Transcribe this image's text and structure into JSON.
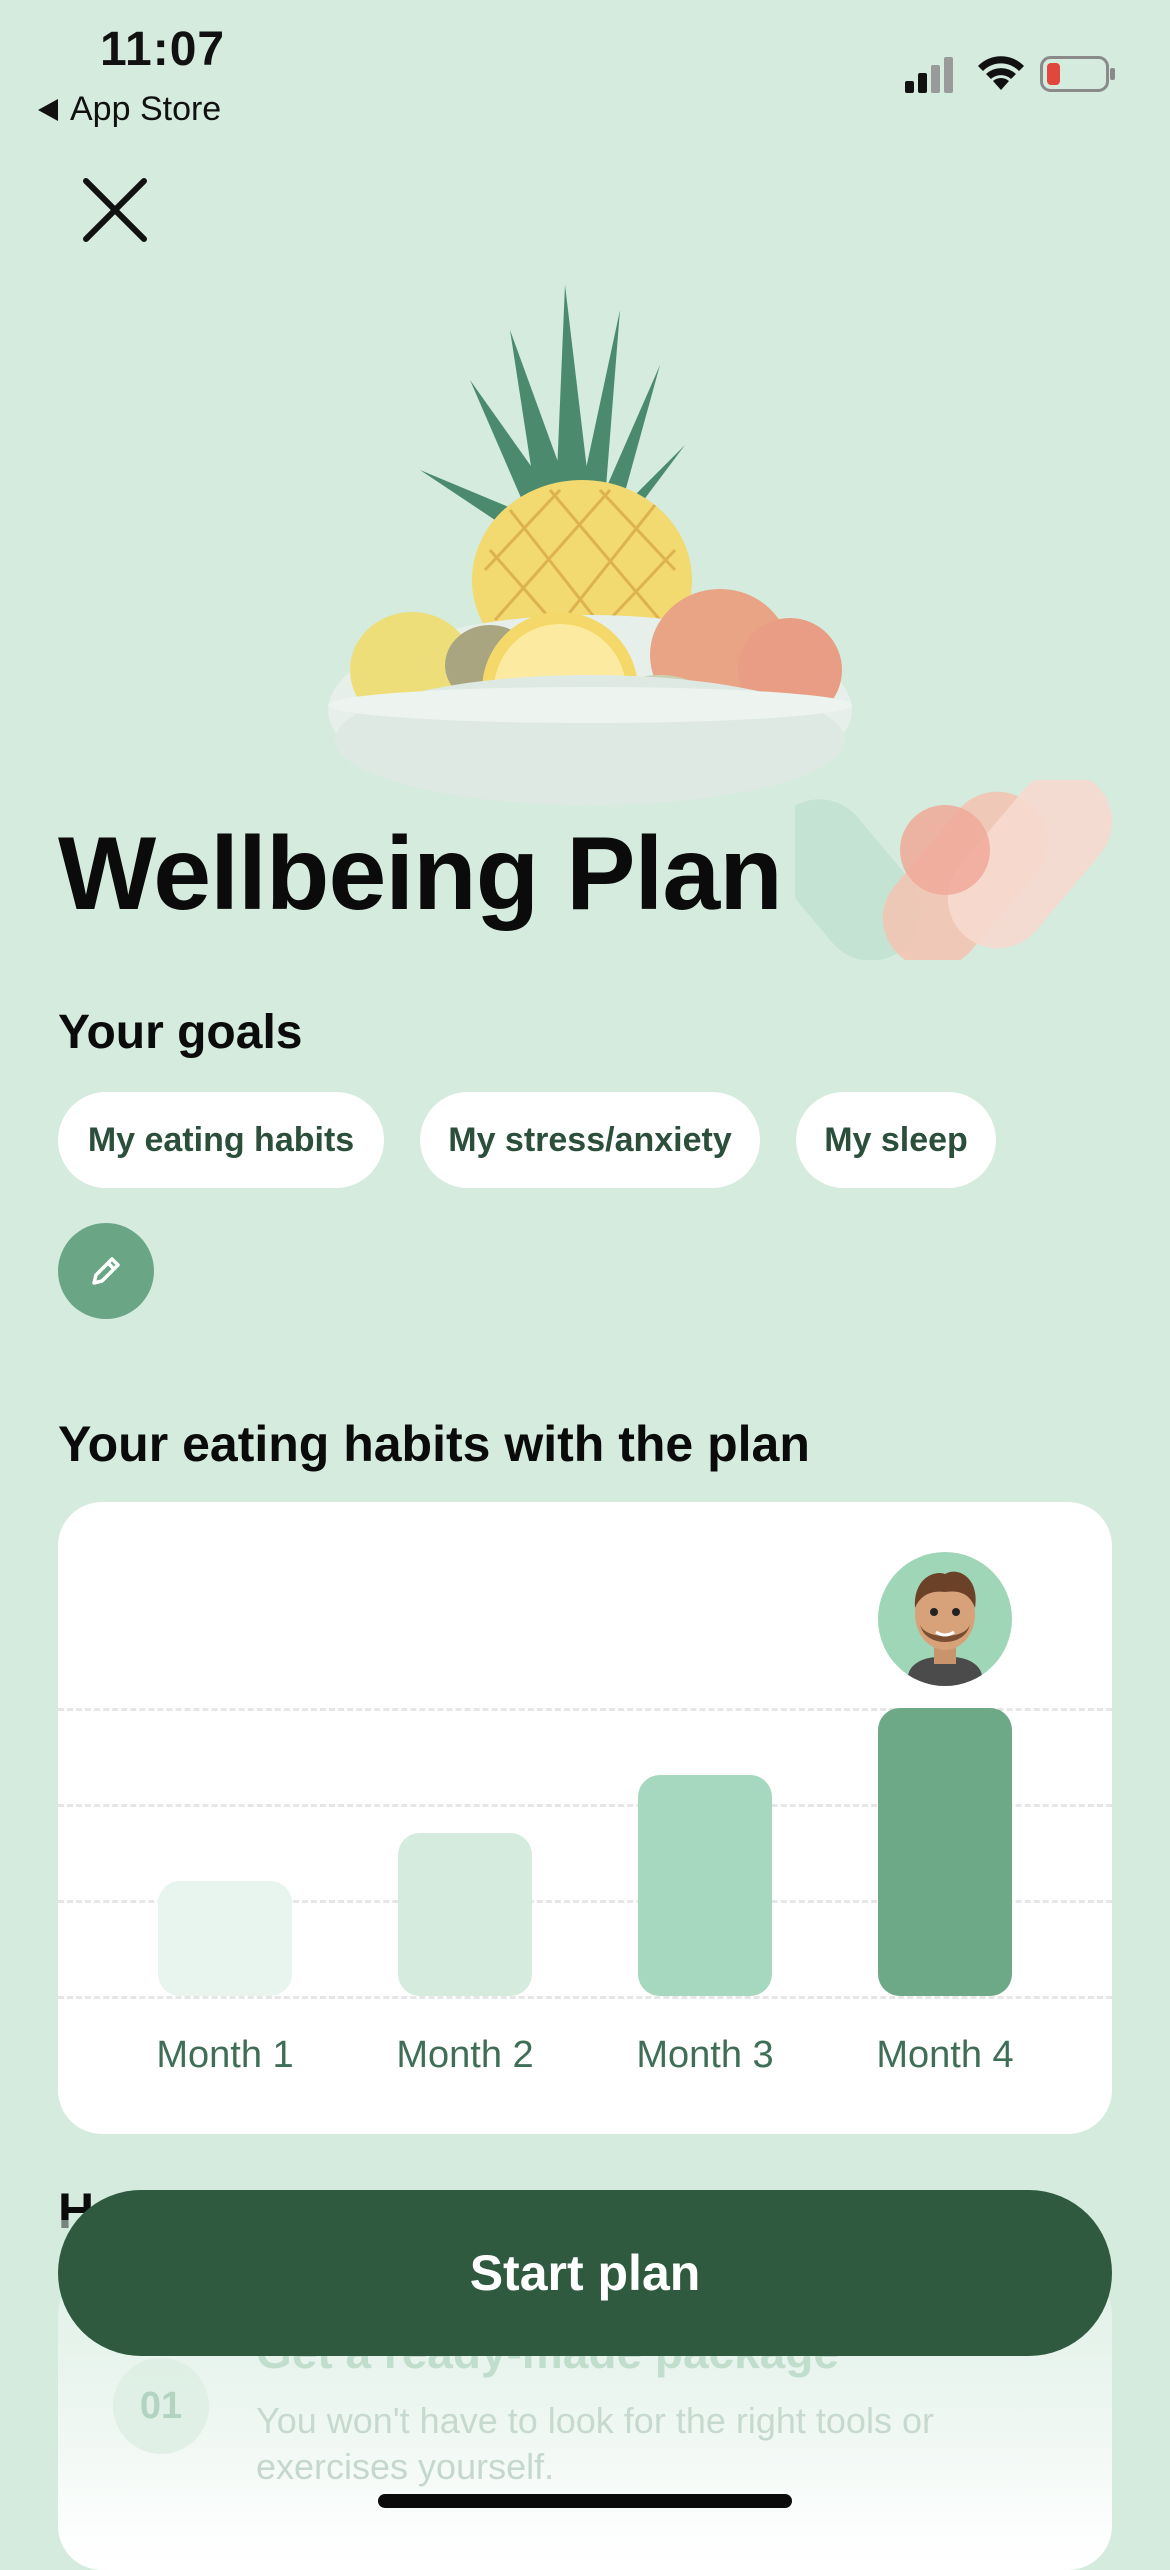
{
  "status_bar": {
    "time": "11:07",
    "back_app": "App Store",
    "icons": [
      "signal-icon",
      "wifi-icon",
      "battery-low-icon"
    ],
    "battery_color": "#e0483d"
  },
  "header": {
    "close_icon": "close-icon"
  },
  "hero": {
    "title": "Wellbeing Plan"
  },
  "goals": {
    "heading": "Your goals",
    "chips": [
      "My eating habits",
      "My stress/anxiety",
      "My sleep"
    ],
    "edit_icon": "pencil-icon"
  },
  "chart_section": {
    "heading": "Your eating habits with the plan"
  },
  "chart_data": {
    "type": "bar",
    "categories": [
      "Month 1",
      "Month 2",
      "Month 3",
      "Month 4"
    ],
    "values": [
      1.2,
      1.7,
      2.3,
      3.0
    ],
    "ylim": [
      0,
      3.0
    ],
    "grid": true,
    "colors": [
      "#e8f4ee",
      "#d4ebde",
      "#a5d8be",
      "#6ea987"
    ]
  },
  "how_it_works": {
    "heading_partial": "H",
    "step": {
      "number": "01",
      "title": "Get a ready-made package",
      "description": "You won't have to look for the right tools or exercises yourself."
    }
  },
  "cta": {
    "label": "Start plan",
    "color": "#2f5a40"
  },
  "theme": {
    "background": "#d4ebde",
    "accent": "#6aa685"
  }
}
